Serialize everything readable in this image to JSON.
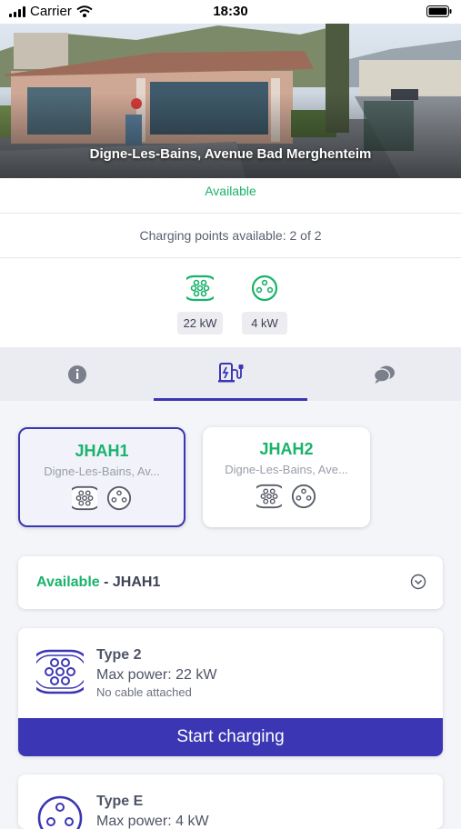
{
  "status_bar": {
    "carrier": "Carrier",
    "time": "18:30"
  },
  "station": {
    "title": "Digne-Les-Bains, Avenue Bad Merghenteim",
    "status": "Available",
    "points_available": "Charging points available: 2 of 2"
  },
  "power_types": [
    {
      "icon": "type2-connector-icon",
      "label": "22 kW"
    },
    {
      "icon": "type-e-connector-icon",
      "label": "4 kW"
    }
  ],
  "tabs": [
    {
      "icon": "info-icon"
    },
    {
      "icon": "charging-station-icon"
    },
    {
      "icon": "chat-icon"
    }
  ],
  "stations": [
    {
      "name": "JHAH1",
      "address": "Digne-Les-Bains, Av..."
    },
    {
      "name": "JHAH2",
      "address": "Digne-Les-Bains, Ave..."
    }
  ],
  "selector": {
    "status": "Available",
    "separator": " - ",
    "station": "JHAH1"
  },
  "connectors": [
    {
      "name": "Type 2",
      "power": "Max power: 22 kW",
      "cable": "No cable attached",
      "button": "Start charging"
    },
    {
      "name": "Type E",
      "power": "Max power: 4 kW"
    }
  ],
  "colors": {
    "accent": "#3b36b3",
    "available": "#19b36b",
    "text": "#2f3447"
  }
}
